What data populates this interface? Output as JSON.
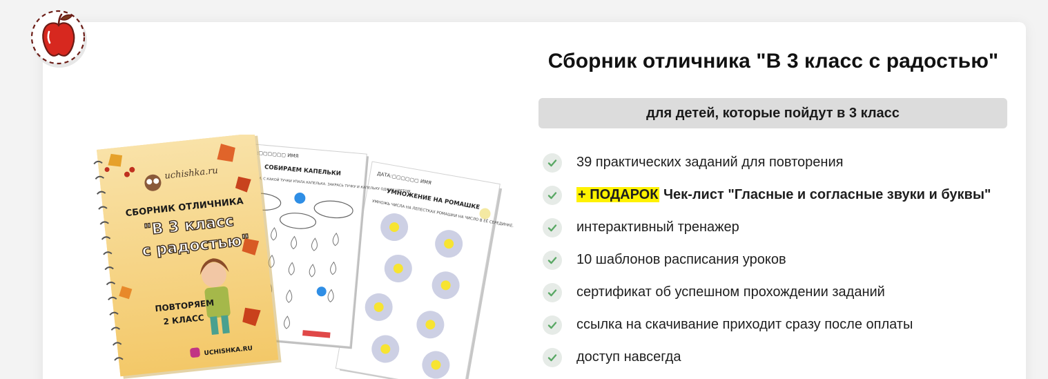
{
  "product": {
    "title": "Сборник отличника \"В 3 класс с радостью\"",
    "subtitle": "для детей, которые пойдут в 3 класс",
    "features": [
      {
        "text": "39 практических заданий для повторения"
      },
      {
        "gift_tag": "+ ПОДАРОК",
        "text": "Чек-лист \"Гласные и согласные звуки и буквы\""
      },
      {
        "text": "интерактивный тренажер"
      },
      {
        "text": "10 шаблонов расписания уроков"
      },
      {
        "text": "сертификат об успешном прохождении заданий"
      },
      {
        "text": "ссылка на скачивание приходит сразу после оплаты"
      },
      {
        "text": "доступ навсегда"
      }
    ]
  },
  "image": {
    "cover_site": "uchishka.ru",
    "cover_line1": "СБОРНИК ОТЛИЧНИКА",
    "cover_line2": "\"В 3 класс",
    "cover_line3": "с радостью\"",
    "cover_line4": "ПОВТОРЯЕМ",
    "cover_line5": "2 КЛАСС",
    "cover_footer": "UCHISHKA.RU",
    "sheet1_header": "ДАТА:▢▢▢▢▢▢  ИМЯ",
    "sheet1_title": "СОБИРАЕМ КАПЕЛЬКИ",
    "sheet1_instr": "ОПРЕДЕЛИ, С КАКОЙ ТУЧКИ УПАЛА КАПЕЛЬКА. ЗАКРАСЬ ТУЧКУ И КАПЕЛЬКУ ОДНИМ ЦВЕТОМ.",
    "sheet2_header": "ДАТА:▢▢▢▢▢▢  ИМЯ",
    "sheet2_title": "УМНОЖЕНИЕ НА РОМАШКЕ",
    "sheet2_instr": "УМНОЖЬ ЧИСЛА НА ЛЕПЕСТКАХ РОМАШКИ НА ЧИСЛО В ЕЁ СЕРЕДИНКЕ."
  },
  "colors": {
    "accent_green": "#5aa865",
    "highlight_yellow": "#fff200",
    "bar_gray": "#dcdcdc",
    "apple_red": "#d7281f"
  }
}
